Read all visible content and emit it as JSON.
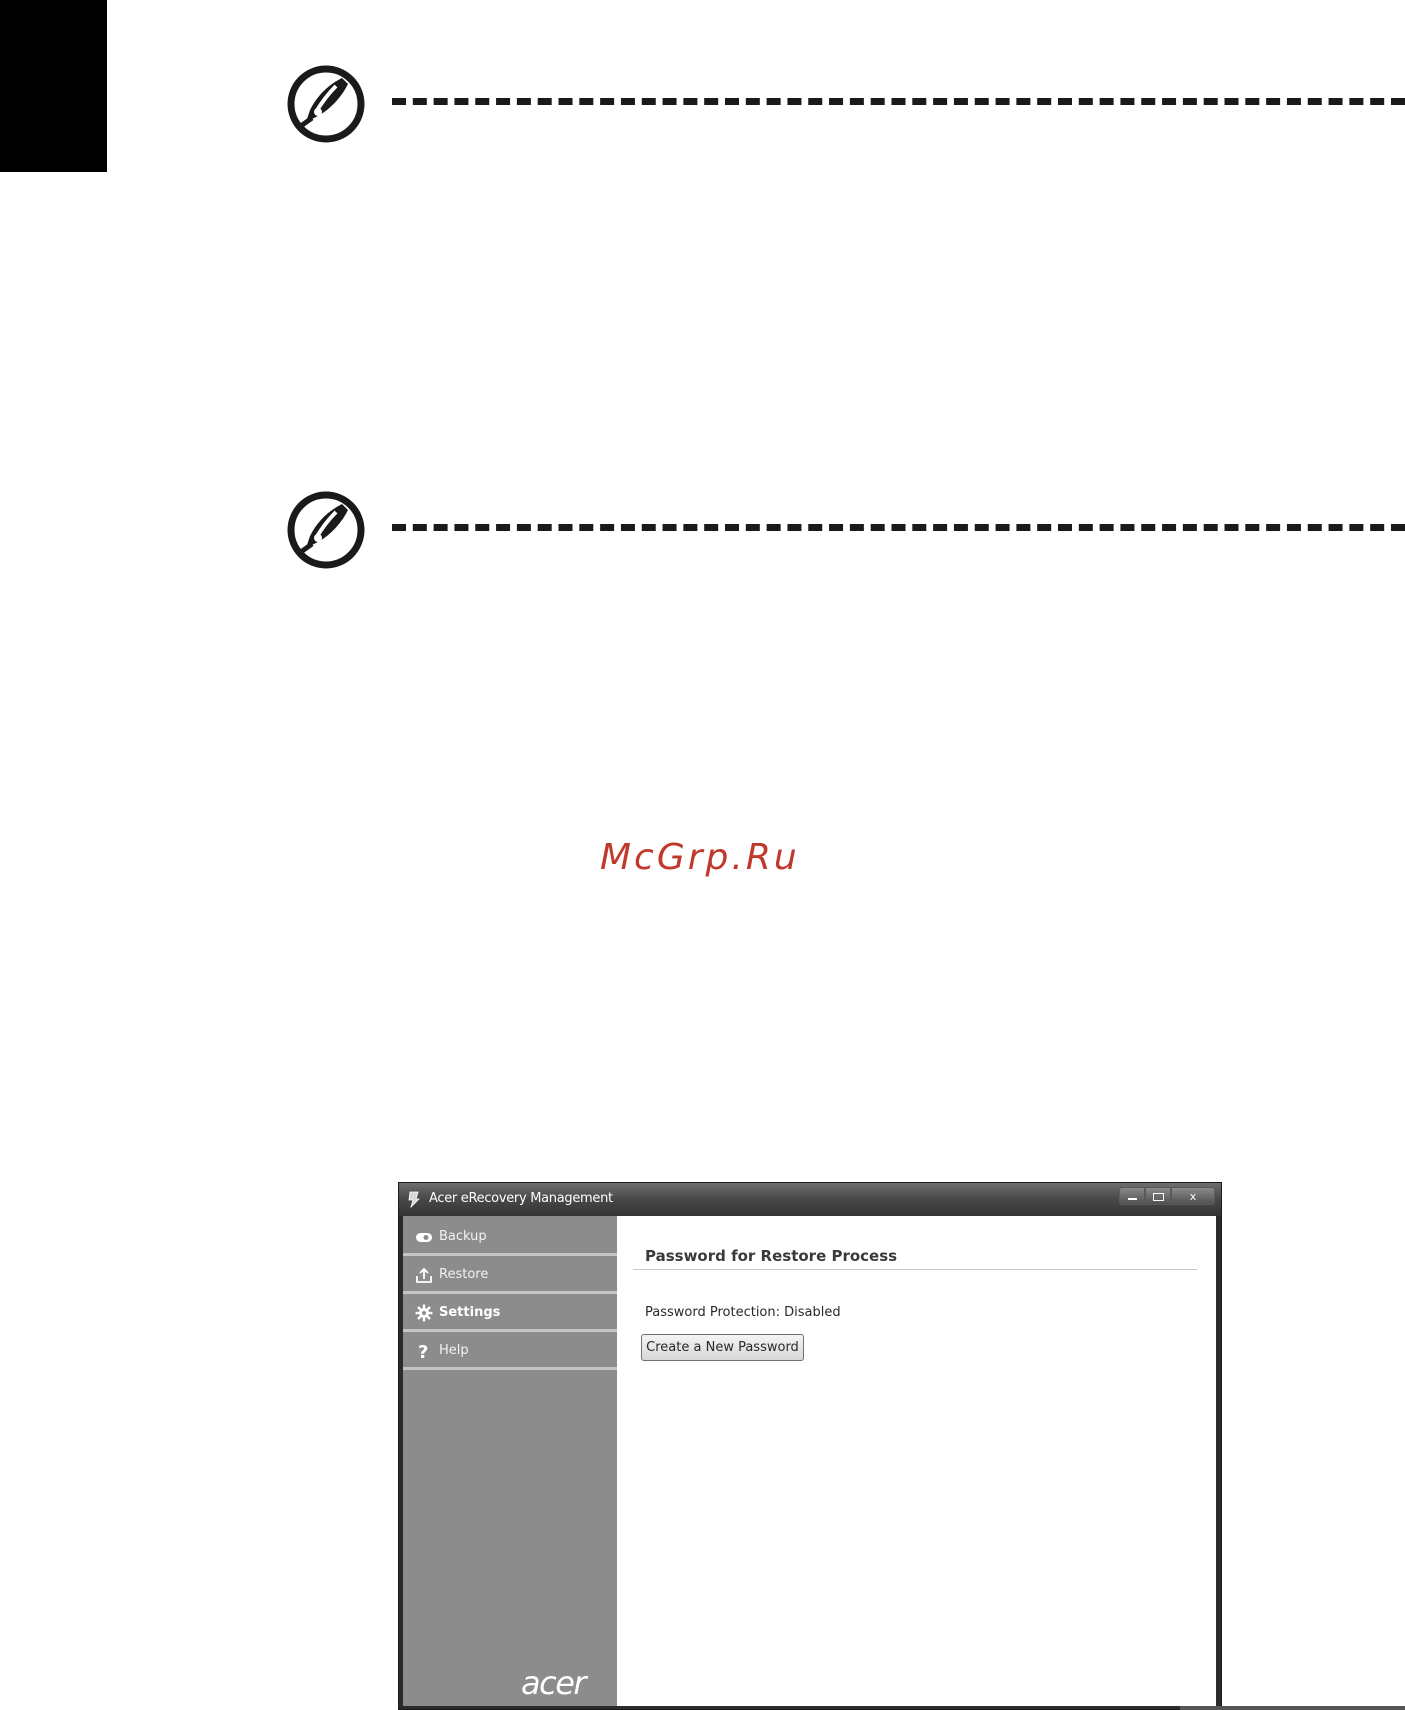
{
  "page": {
    "watermark": "McGrp.Ru"
  },
  "window": {
    "title": "Acer eRecovery Management",
    "controls": {
      "minimize_icon": "minimize-icon",
      "maximize_icon": "maximize-icon",
      "close_label": "x"
    },
    "sidebar": {
      "items": [
        {
          "label": "Backup",
          "icon": "backup-icon",
          "active": false
        },
        {
          "label": "Restore",
          "icon": "restore-icon",
          "active": false
        },
        {
          "label": "Settings",
          "icon": "gear-icon",
          "active": true
        },
        {
          "label": "Help",
          "icon": "help-icon",
          "active": false
        }
      ],
      "logo": "acer"
    },
    "content": {
      "heading": "Password for Restore Process",
      "status": "Password Protection: Disabled",
      "create_button_label": "Create a New Password"
    }
  },
  "colors": {
    "sidebar_bg": "#8c8c8c",
    "titlebar": "#4a4a4a",
    "watermark": "#c0392b"
  }
}
